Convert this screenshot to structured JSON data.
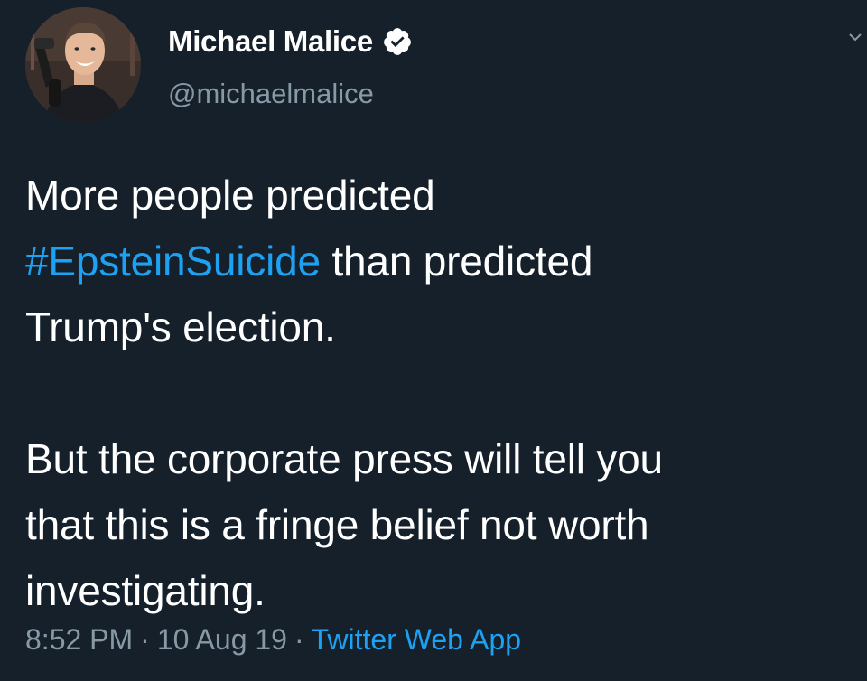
{
  "tweet": {
    "author": {
      "display_name": "Michael Malice",
      "handle": "@michaelmalice",
      "verified": true
    },
    "text": {
      "line1": "More people predicted",
      "hashtag": "#EpsteinSuicide",
      "line2_rest": " than predicted",
      "line3": "Trump's election.",
      "line4": "But the corporate press will tell you",
      "line5": "that this is a fringe belief not worth",
      "line6": "investigating."
    },
    "meta": {
      "time": "8:52 PM",
      "separator": "·",
      "date": "10 Aug 19",
      "source": "Twitter Web App"
    }
  },
  "colors": {
    "background": "#15202b",
    "text": "#ffffff",
    "muted": "#8899a6",
    "accent": "#1da1f2"
  },
  "icons": {
    "verified": "verified-badge-icon",
    "menu": "chevron-down-icon"
  }
}
